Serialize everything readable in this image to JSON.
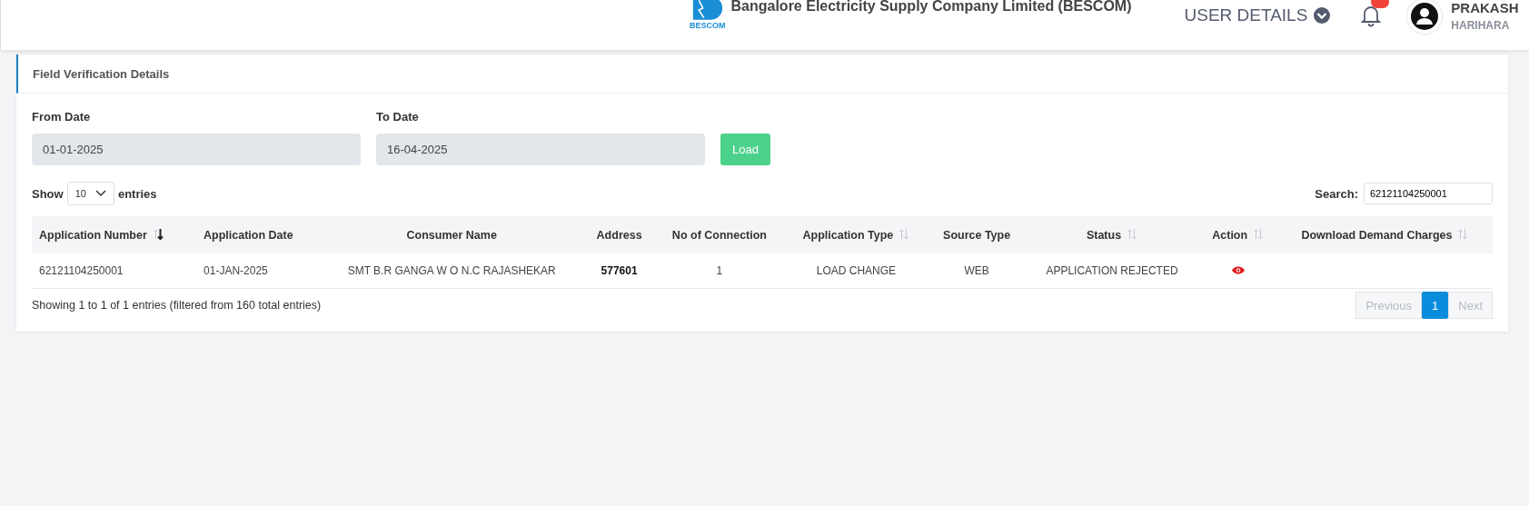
{
  "header": {
    "logo_text": "BESCOM",
    "company": "Bangalore Electricity Supply Company Limited (BESCOM)",
    "user_menu": "USER DETAILS",
    "notifications": {
      "has_unread": true
    },
    "user": {
      "name": "PRAKASH",
      "subtitle": "HARIHARA"
    }
  },
  "card": {
    "title": "Field Verification Details",
    "filters": [
      {
        "label": "From Date",
        "value": "01-01-2025"
      },
      {
        "label": "To Date",
        "value": "16-04-2025"
      }
    ],
    "load_button": "Load",
    "length": {
      "before": "Show",
      "value": "10",
      "after": "entries"
    },
    "search": {
      "label": "Search:",
      "value": "62121104250001"
    },
    "table": {
      "columns": [
        {
          "label": "Application Number",
          "sortable": true,
          "sorted": true
        },
        {
          "label": "Application Date",
          "sortable": false
        },
        {
          "label": "Consumer Name",
          "sortable": false
        },
        {
          "label": "Address",
          "sortable": false
        },
        {
          "label": "No of Connection",
          "sortable": false
        },
        {
          "label": "Application Type",
          "sortable": true,
          "sorted": false
        },
        {
          "label": "Source Type",
          "sortable": false
        },
        {
          "label": "Status",
          "sortable": true,
          "sorted": false
        },
        {
          "label": "Action",
          "sortable": true,
          "sorted": false
        },
        {
          "label": "Download Demand Charges",
          "sortable": true,
          "sorted": false
        }
      ],
      "rows": [
        {
          "cells": [
            {
              "kind": "text",
              "text": "62121104250001"
            },
            {
              "kind": "text",
              "text": "01-JAN-2025"
            },
            {
              "kind": "text",
              "text": "SMT B.R GANGA W O N.C RAJASHEKAR"
            },
            {
              "kind": "strong",
              "text": "577601"
            },
            {
              "kind": "text",
              "text": "1"
            },
            {
              "kind": "text",
              "text": "LOAD CHANGE"
            },
            {
              "kind": "text",
              "text": "WEB"
            },
            {
              "kind": "text",
              "text": "APPLICATION REJECTED"
            },
            {
              "kind": "view"
            },
            {
              "kind": "empty"
            }
          ]
        }
      ]
    },
    "info": "Showing 1 to 1 of 1 entries (filtered from 160 total entries)",
    "pagination": [
      {
        "label": "Previous",
        "disabled": true,
        "selected": false
      },
      {
        "label": "1",
        "disabled": false,
        "selected": true
      },
      {
        "label": "Next",
        "disabled": true,
        "selected": false
      }
    ]
  }
}
